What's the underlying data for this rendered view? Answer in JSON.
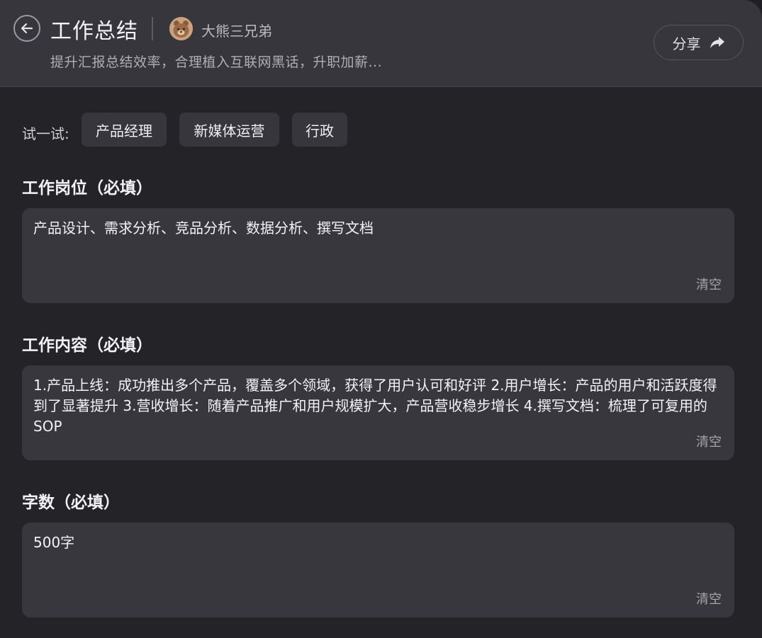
{
  "header": {
    "title": "工作总结",
    "author": "大熊三兄弟",
    "subtitle": "提升汇报总结效率，合理植入互联网黑话，升职加薪...",
    "share_label": "分享"
  },
  "try": {
    "label": "试一试:",
    "chips": [
      "产品经理",
      "新媒体运营",
      "行政"
    ]
  },
  "fields": [
    {
      "label": "工作岗位（必填）",
      "value": "产品设计、需求分析、竞品分析、数据分析、撰写文档",
      "clear_label": "清空"
    },
    {
      "label": "工作内容（必填）",
      "value": "1.产品上线：成功推出多个产品，覆盖多个领域，获得了用户认可和好评 2.用户增长：产品的用户和活跃度得到了显著提升 3.营收增长：随着产品推广和用户规模扩大，产品营收稳步增长 4.撰写文档：梳理了可复用的SOP",
      "clear_label": "清空"
    },
    {
      "label": "字数（必填）",
      "value": "500字",
      "clear_label": "清空"
    }
  ],
  "icons": {
    "back": "arrow-left-icon",
    "share": "share-arrow-icon",
    "avatar": "bear-avatar"
  }
}
